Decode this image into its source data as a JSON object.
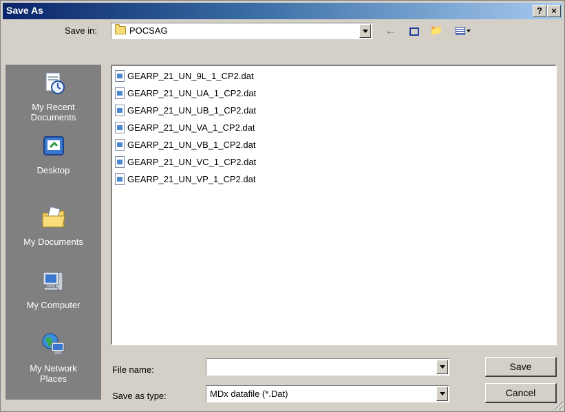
{
  "window": {
    "title": "Save As",
    "help_label": "?",
    "close_label": "×"
  },
  "toolbar": {
    "save_in_label": "Save in:",
    "save_in_value": "POCSAG",
    "back_icon": "back-arrow-icon",
    "up_icon": "up-one-level-icon",
    "new_folder_icon": "new-folder-icon",
    "views_icon": "views-menu-icon"
  },
  "places": [
    {
      "label": "My Recent\nDocuments",
      "icon": "recent-documents-icon"
    },
    {
      "label": "Desktop",
      "icon": "desktop-icon"
    },
    {
      "label": "My Documents",
      "icon": "my-documents-icon"
    },
    {
      "label": "My Computer",
      "icon": "my-computer-icon"
    },
    {
      "label": "My Network\nPlaces",
      "icon": "network-places-icon"
    }
  ],
  "files": [
    "GEARP_21_UN_9L_1_CP2.dat",
    "GEARP_21_UN_UA_1_CP2.dat",
    "GEARP_21_UN_UB_1_CP2.dat",
    "GEARP_21_UN_VA_1_CP2.dat",
    "GEARP_21_UN_VB_1_CP2.dat",
    "GEARP_21_UN_VC_1_CP2.dat",
    "GEARP_21_UN_VP_1_CP2.dat"
  ],
  "form": {
    "file_name_label": "File name:",
    "file_name_value": "",
    "save_type_label": "Save as type:",
    "save_type_value": "MDx datafile (*.Dat)"
  },
  "buttons": {
    "save": "Save",
    "cancel": "Cancel"
  }
}
